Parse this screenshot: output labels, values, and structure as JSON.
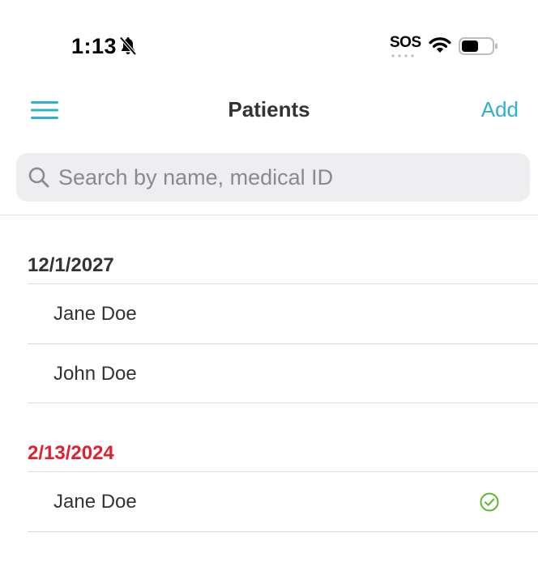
{
  "status_bar": {
    "time": "1:13",
    "carrier": "SOS",
    "icons": [
      "bell-slash-icon",
      "wifi-icon",
      "battery-icon"
    ]
  },
  "nav": {
    "title": "Patients",
    "add_label": "Add",
    "menu_icon": "hamburger-menu-icon"
  },
  "search": {
    "placeholder": "Search by name, medical ID",
    "value": ""
  },
  "colors": {
    "accent": "#2db3cc",
    "overdue": "#e0202e",
    "complete": "#5cb82e"
  },
  "sections": [
    {
      "date": "12/1/2027",
      "highlight": false,
      "patients": [
        {
          "name": "Jane Doe",
          "completed": false
        },
        {
          "name": "John Doe",
          "completed": false
        }
      ]
    },
    {
      "date": "2/13/2024",
      "highlight": true,
      "patients": [
        {
          "name": "Jane Doe",
          "completed": true
        }
      ]
    }
  ]
}
